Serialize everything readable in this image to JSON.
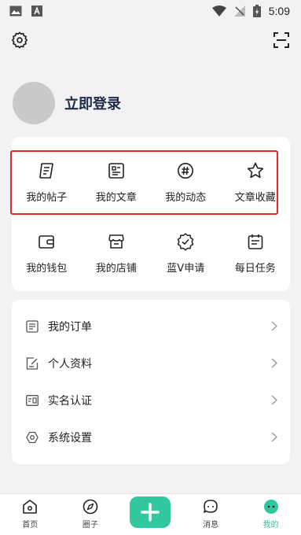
{
  "status": {
    "time": "5:09"
  },
  "header": {
    "settings_icon": "gear-icon",
    "scan_icon": "scan-icon"
  },
  "profile": {
    "login_label": "立即登录"
  },
  "grid": {
    "row1": [
      {
        "label": "我的帖子",
        "icon": "post-icon"
      },
      {
        "label": "我的文章",
        "icon": "article-icon"
      },
      {
        "label": "我的动态",
        "icon": "hashtag-icon"
      },
      {
        "label": "文章收藏",
        "icon": "star-icon"
      }
    ],
    "row2": [
      {
        "label": "我的钱包",
        "icon": "wallet-icon"
      },
      {
        "label": "我的店铺",
        "icon": "shop-icon"
      },
      {
        "label": "蓝V申请",
        "icon": "verified-badge-icon"
      },
      {
        "label": "每日任务",
        "icon": "calendar-task-icon"
      }
    ]
  },
  "menu": [
    {
      "label": "我的订单",
      "icon": "order-list-icon"
    },
    {
      "label": "个人资料",
      "icon": "edit-profile-icon"
    },
    {
      "label": "实名认证",
      "icon": "id-card-icon"
    },
    {
      "label": "系统设置",
      "icon": "settings-hexagon-icon"
    }
  ],
  "tabs": [
    {
      "label": "首页",
      "icon": "home-icon"
    },
    {
      "label": "圈子",
      "icon": "compass-icon"
    },
    {
      "label": "",
      "icon": "plus-icon"
    },
    {
      "label": "消息",
      "icon": "message-icon"
    },
    {
      "label": "我的",
      "icon": "profile-face-icon",
      "active": true
    }
  ],
  "colors": {
    "accent": "#33c79f",
    "highlight": "#e5282a",
    "background": "#f2f2f4"
  }
}
